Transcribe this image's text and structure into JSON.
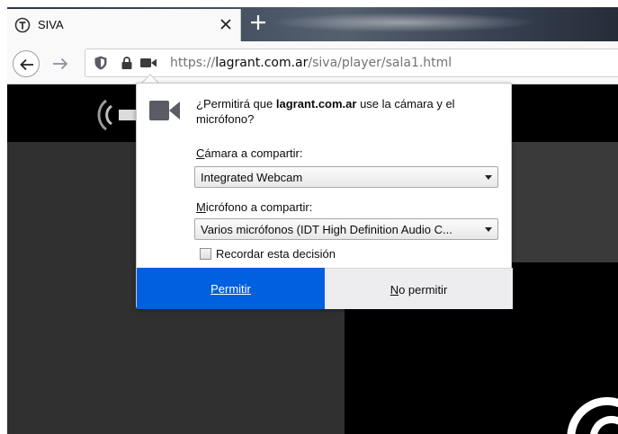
{
  "tab": {
    "title": "SIVA",
    "close_icon": "close-icon",
    "new_tab_icon": "plus-icon"
  },
  "navbar": {
    "url_scheme": "https://",
    "url_host": "lagrant.com.ar",
    "url_path": "/siva/player/sala1.html"
  },
  "permission": {
    "message_prefix": "¿Permitirá que ",
    "site": "lagrant.com.ar",
    "message_suffix": " use la cámara y el micrófono?",
    "camera_label_accel": "C",
    "camera_label_rest": "ámara a compartir:",
    "camera_selected": "Integrated Webcam",
    "mic_label_accel": "M",
    "mic_label_rest": "icrófono a compartir:",
    "mic_selected": "Varios micrófonos (IDT High Definition Audio C...",
    "remember_label": "Recordar esta decisión",
    "allow_accel": "P",
    "allow_rest": "ermitir",
    "deny_accel": "N",
    "deny_rest": "o permitir"
  },
  "colors": {
    "allow_button": "#0060df",
    "deny_button": "#ededf0",
    "tab_bg": "#f9f9fa"
  }
}
